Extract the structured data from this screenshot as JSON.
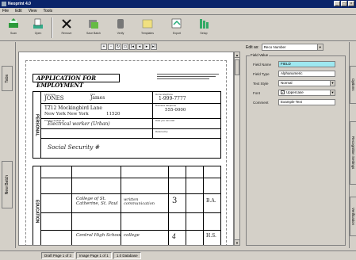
{
  "window": {
    "title": "Neoprint 4.0"
  },
  "menu": [
    "File",
    "Edit",
    "View",
    "Tools"
  ],
  "toolbar": [
    {
      "label": "Scan",
      "icon": "scanner-icon"
    },
    {
      "label": "Open",
      "icon": "open-document-icon"
    },
    {
      "label": "Remove",
      "icon": "delete-x-icon"
    },
    {
      "label": "Save Batch",
      "icon": "save-batch-icon"
    },
    {
      "label": "Verify",
      "icon": "verify-icon"
    },
    {
      "label": "Templates",
      "icon": "template-icon"
    },
    {
      "label": "Export",
      "icon": "export-icon"
    },
    {
      "label": "Setup",
      "icon": "setup-icon"
    }
  ],
  "left_tabs": {
    "top": "Tabs",
    "bottom": "New Batch"
  },
  "nav_buttons": [
    "zoom-in",
    "zoom-out",
    "rotate",
    "fit",
    "first",
    "prev",
    "next",
    "last"
  ],
  "form": {
    "title": "APPLICATION FOR EMPLOYMENT",
    "last_name": "JONES",
    "first_name": "James",
    "street": "1212 Mockingbird Lane",
    "city_state": "New York     New York",
    "zip": "11520",
    "phone": "1-999-7777",
    "phone2": "555-0000",
    "position": "Electrical worker (Urban)",
    "social": "Social   Security   #",
    "edu_college": "College of St. Catherine, St. Paul",
    "edu_major": "written communication",
    "edu_years": "3",
    "edu_degree": "B.A.",
    "edu_hs": "Central High School",
    "edu_hs_type": "college",
    "edu_hs_years": "4",
    "edu_hs_degree": "H.S.",
    "side_personal": "PERSONAL",
    "side_education": "EDUCATION"
  },
  "props": {
    "edit_label": "Edit as:",
    "edit_value": "Reco Number",
    "group_title": "Field Value",
    "rows": [
      {
        "key": "Field Name",
        "value": "FIELD"
      },
      {
        "key": "Field Type",
        "value": "Alphanumeric"
      },
      {
        "key": "Text Style",
        "value": "Normal"
      },
      {
        "key": "Font",
        "value": "Uppercase"
      },
      {
        "key": "Comment",
        "value": "Example Text"
      }
    ]
  },
  "right_tabs": [
    "Options",
    "Recognition Settings",
    "Verification"
  ],
  "status": [
    "Draft  Page 1 of 3",
    "Image Page 1 of 1",
    "1.0 Database"
  ]
}
